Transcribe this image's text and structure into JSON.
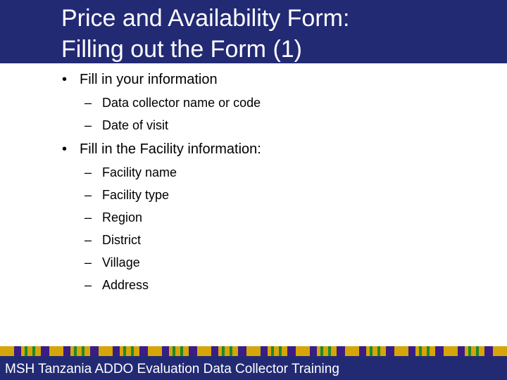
{
  "title": {
    "line1": "Price and Availability Form:",
    "line2": "Filling out the Form (1)"
  },
  "bullets": [
    {
      "text": "Fill in your information",
      "subs": [
        "Data collector name or code",
        "Date of visit"
      ]
    },
    {
      "text": "Fill in the Facility information:",
      "subs": [
        "Facility name",
        "Facility type",
        "Region",
        "District",
        "Village",
        "Address"
      ]
    }
  ],
  "symbols": {
    "bullet": "•",
    "dash": "–"
  },
  "footer": {
    "text": "MSH Tanzania ADDO Evaluation Data Collector Training"
  },
  "colors": {
    "header": "#232a74",
    "stripe_gold": "#d6a50a",
    "stripe_purple": "#3b1d86",
    "stripe_green": "#1d8a2c"
  }
}
